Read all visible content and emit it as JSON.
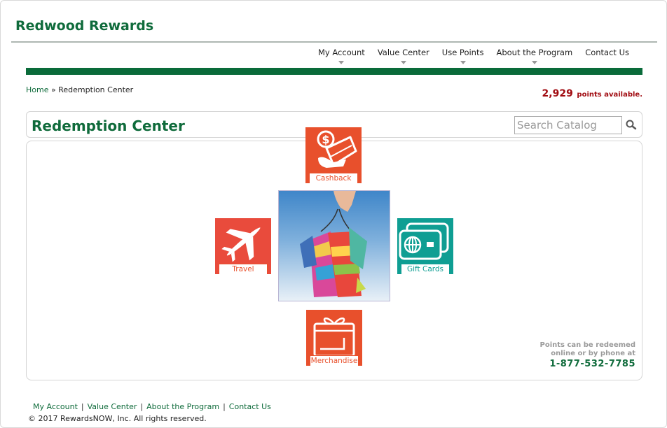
{
  "brand": "Redwood Rewards",
  "topnav": [
    {
      "label": "My Account"
    },
    {
      "label": "Value Center"
    },
    {
      "label": "Use Points"
    },
    {
      "label": "About the Program"
    },
    {
      "label": "Contact Us"
    }
  ],
  "breadcrumb": {
    "home": "Home",
    "separator": "»",
    "current": "Redemption Center"
  },
  "points": {
    "value": "2,929",
    "label": "points available."
  },
  "page_title": "Redemption Center",
  "search": {
    "placeholder": "Search Catalog",
    "icon": "search-icon"
  },
  "tiles": {
    "cashback": {
      "label": "Cashback",
      "icon": "cashback-icon",
      "color": "#e8502c"
    },
    "travel": {
      "label": "Travel",
      "icon": "airplane-icon",
      "color": "#e94b3c"
    },
    "gift_cards": {
      "label": "Gift Cards",
      "icon": "gift-card-icon",
      "color": "#0f9e93"
    },
    "merchandise": {
      "label": "Merchandise",
      "icon": "gift-box-icon",
      "color": "#e8502c"
    }
  },
  "redeem_note": {
    "line1": "Points can be redeemed",
    "line2": "online or by phone at",
    "phone": "1-877-532-7785"
  },
  "footer": {
    "links": [
      "My Account",
      "Value Center",
      "About the Program",
      "Contact Us"
    ],
    "copyright": "© 2017 RewardsNOW, Inc. All rights reserved."
  },
  "colors": {
    "brand_green": "#0f6b3b",
    "bar_green": "#0a6b3a",
    "points_red": "#a10c12"
  }
}
